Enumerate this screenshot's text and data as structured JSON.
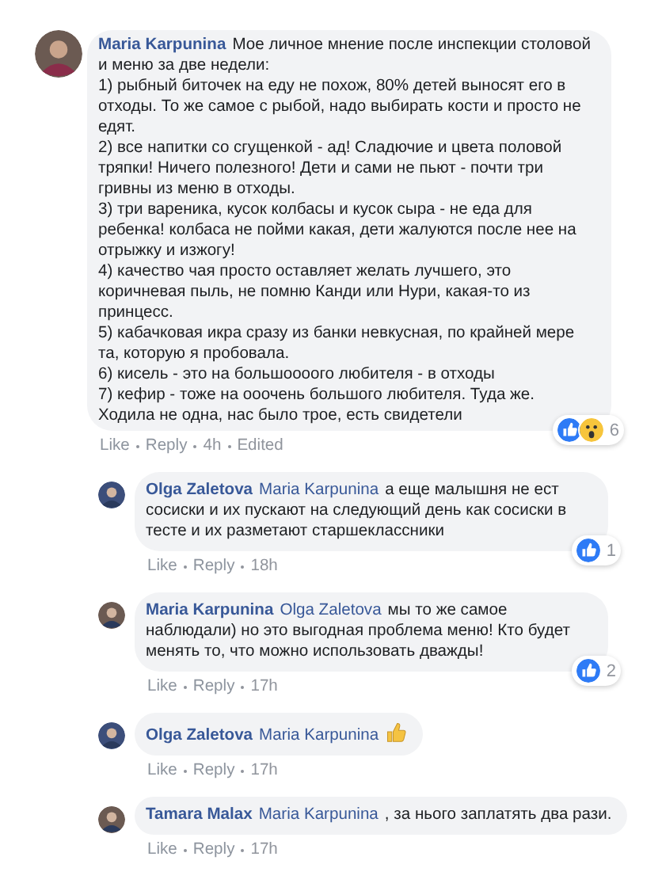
{
  "comments": [
    {
      "author": "Maria Karpunina",
      "text": "Мое личное мнение после инспекции столовой и меню за две недели:\n1) рыбный биточек на еду не похож, 80% детей выносят его в отходы. То же самое с рыбой, надо выбирать кости и просто не едят.\n2) все напитки со сгущенкой - ад! Сладючие и цвета половой тряпки! Ничего полезного! Дети и сами не пьют - почти три гривны из меню в отходы.\n3) три вареника, кусок колбасы и кусок сыра - не еда для ребенка! колбаса не пойми какая, дети жалуются после нее на отрыжку и изжогу!\n4) качество чая просто оставляет желать лучшего, это коричневая пыль, не помню Канди или Нури, какая-то из принцесс.\n5) кабачковая икра сразу из банки невкусная, по крайней мере та, которую я пробовала.\n6) кисель - это на большоооого любителя - в отходы\n7) кефир - тоже на ооочень большого любителя. Туда же. Ходила не одна, нас было трое, есть свидетели",
      "actions": [
        "Like",
        "Reply",
        "4h",
        "Edited"
      ],
      "reactions": {
        "icons": [
          {
            "kind": "like"
          },
          {
            "kind": "wow"
          }
        ],
        "count": "6"
      },
      "replies": [
        {
          "author": "Olga Zaletova",
          "mention": "Maria Karpunina",
          "text": "а еще малышня не ест сосиски и их пускают на следующий день как сосиски в тесте и их разметают старшеклассники",
          "actions": [
            "Like",
            "Reply",
            "18h"
          ],
          "reactions": {
            "icons": [
              {
                "kind": "like"
              }
            ],
            "count": "1"
          }
        },
        {
          "author": "Maria Karpunina",
          "mention": "Olga Zaletova",
          "text": "мы то же самое наблюдали) но это выгодная проблема меню! Кто будет менять то, что можно использовать дважды!",
          "actions": [
            "Like",
            "Reply",
            "17h"
          ],
          "reactions": {
            "icons": [
              {
                "kind": "like"
              }
            ],
            "count": "2"
          }
        },
        {
          "author": "Olga Zaletova",
          "mention": "Maria Karpunina",
          "attachment": {
            "kind": "thumbs-up"
          },
          "actions": [
            "Like",
            "Reply",
            "17h"
          ]
        },
        {
          "author": "Tamara Malax",
          "mention": "Maria Karpunina",
          "text": ", за нього заплатять два рази.",
          "actions": [
            "Like",
            "Reply",
            "17h"
          ]
        }
      ]
    }
  ]
}
